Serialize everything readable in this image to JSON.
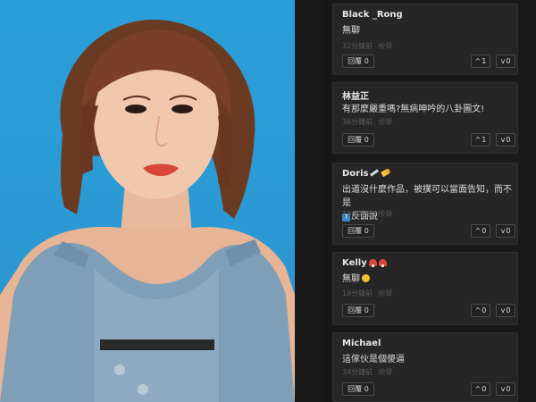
{
  "comments": [
    {
      "author": "Black _Rong",
      "text": "無聊",
      "time": "32分鐘前",
      "tag": "檢舉",
      "reply_label": "回覆 0",
      "up_label": "1",
      "down_label": "0"
    },
    {
      "author": "林益正",
      "text": "有那麼嚴重嗎?無病呻吟的八卦圖文!",
      "time": "36分鐘前",
      "tag": "檢舉",
      "reply_label": "回覆 0",
      "up_label": "1",
      "down_label": "0"
    },
    {
      "author": "Doris",
      "text_line1": "出道沒什麼作品，被撲可以當面告知，而不是",
      "text_line2": "反面說",
      "time": "13分鐘前",
      "tag": "檢舉",
      "reply_label": "回覆 0",
      "up_label": "0",
      "down_label": "0"
    },
    {
      "author": "Kelly",
      "text": "無聊",
      "time": "19分鐘前",
      "tag": "檢舉",
      "reply_label": "回覆 0",
      "up_label": "0",
      "down_label": "0"
    },
    {
      "author": "Michael",
      "text": "這傢伙是個傻逼",
      "time": "34分鐘前",
      "tag": "檢舉",
      "reply_label": "回覆 0",
      "up_label": "0",
      "down_label": "0"
    }
  ],
  "icons": {
    "up": "chevron-up-icon",
    "down": "chevron-down-icon",
    "doris_badges": [
      "syringe-icon",
      "comet-icon"
    ],
    "kelly_badges": [
      "mushroom-icon",
      "mushroom-icon"
    ],
    "kelly_reaction": "smile-icon",
    "doris_reaction": "up-arrow-box-icon"
  },
  "colors": {
    "background": "#191919",
    "card": "#262626",
    "photo_backdrop": "#2a9ed8"
  }
}
